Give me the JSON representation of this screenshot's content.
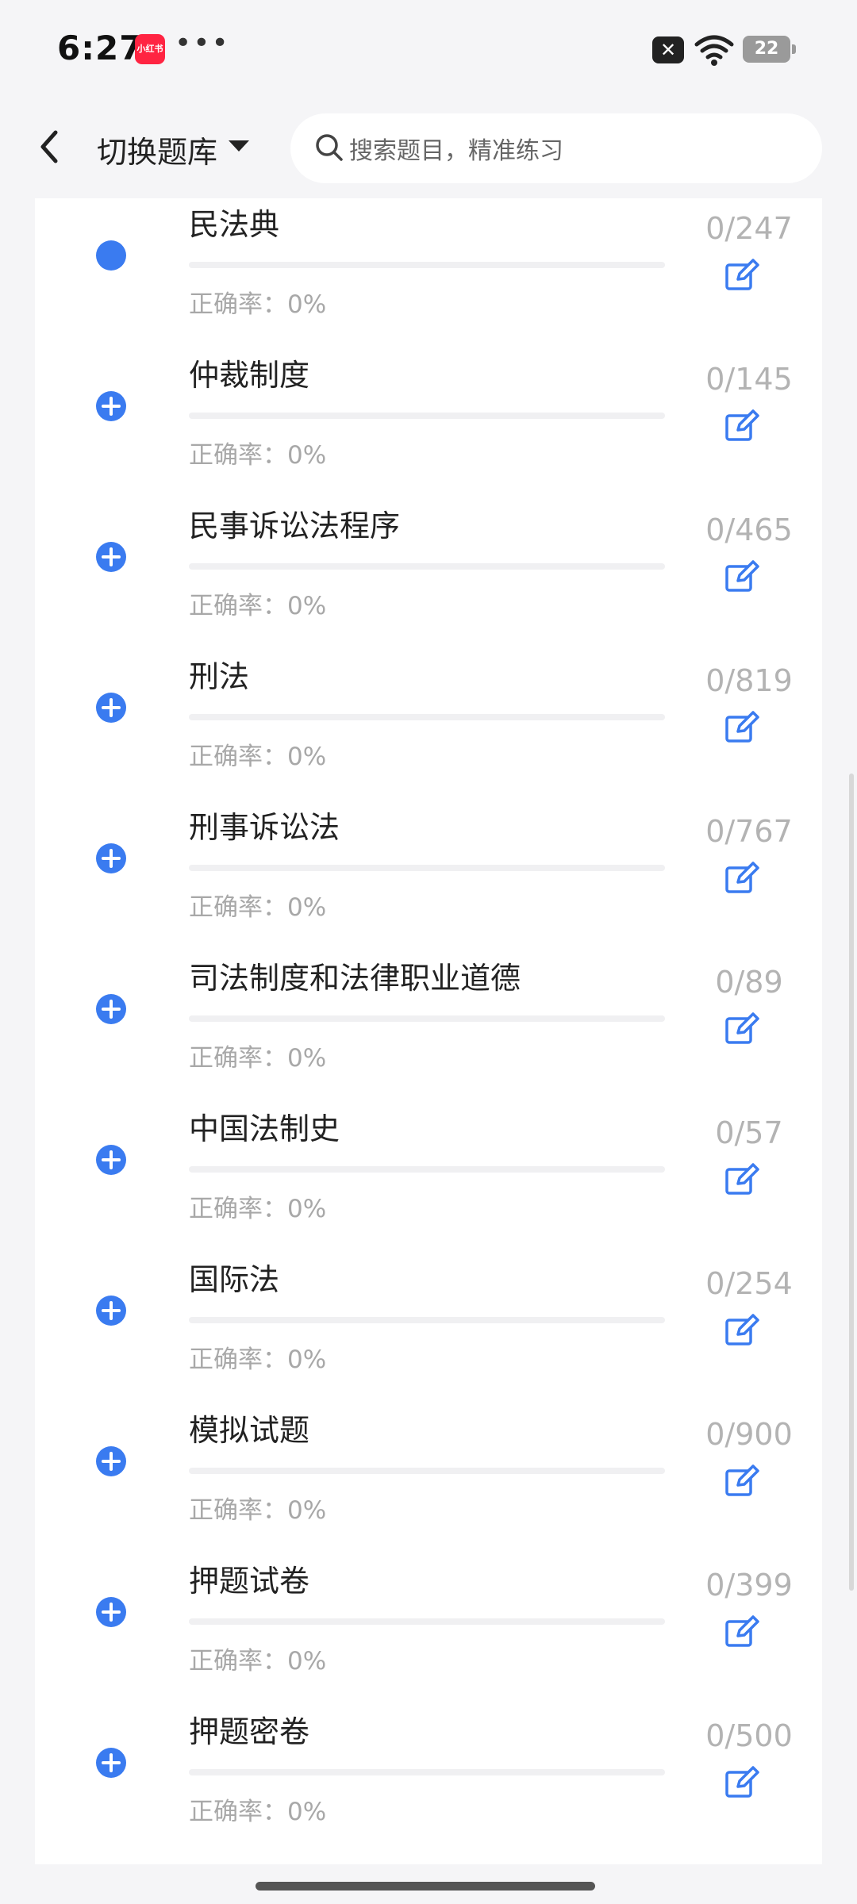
{
  "status_bar": {
    "time": "6:27",
    "app_badge_icon": "xiaohongshu-app-icon",
    "app_badge_text": "小红书",
    "more_icon": "more-dots-icon",
    "battery": "22"
  },
  "header": {
    "back_icon": "chevron-left-icon",
    "switch_label": "切换题库",
    "switch_caret_icon": "caret-down-icon",
    "search_icon": "search-icon",
    "search_placeholder": "搜索题目，精准练习"
  },
  "list": {
    "accuracy_label_prefix": "正确率：",
    "items": [
      {
        "title": "民法典",
        "accuracy": "0%",
        "count": "0/247",
        "marker": "dot-icon",
        "progress": 0
      },
      {
        "title": "仲裁制度",
        "accuracy": "0%",
        "count": "0/145",
        "marker": "plus-circle-icon",
        "progress": 0
      },
      {
        "title": "民事诉讼法程序",
        "accuracy": "0%",
        "count": "0/465",
        "marker": "plus-circle-icon",
        "progress": 0
      },
      {
        "title": "刑法",
        "accuracy": "0%",
        "count": "0/819",
        "marker": "plus-circle-icon",
        "progress": 0
      },
      {
        "title": "刑事诉讼法",
        "accuracy": "0%",
        "count": "0/767",
        "marker": "plus-circle-icon",
        "progress": 0
      },
      {
        "title": "司法制度和法律职业道德",
        "accuracy": "0%",
        "count": "0/89",
        "marker": "plus-circle-icon",
        "progress": 0
      },
      {
        "title": "中国法制史",
        "accuracy": "0%",
        "count": "0/57",
        "marker": "plus-circle-icon",
        "progress": 0
      },
      {
        "title": "国际法",
        "accuracy": "0%",
        "count": "0/254",
        "marker": "plus-circle-icon",
        "progress": 0
      },
      {
        "title": "模拟试题",
        "accuracy": "0%",
        "count": "0/900",
        "marker": "plus-circle-icon",
        "progress": 0
      },
      {
        "title": "押题试卷",
        "accuracy": "0%",
        "count": "0/399",
        "marker": "plus-circle-icon",
        "progress": 0
      },
      {
        "title": "押题密卷",
        "accuracy": "0%",
        "count": "0/500",
        "marker": "plus-circle-icon",
        "progress": 0
      }
    ]
  },
  "colors": {
    "accent": "#3a7bf0",
    "muted_text": "#a8a8a8",
    "count_text": "#b3b3b3",
    "track": "#f0f0f2"
  }
}
